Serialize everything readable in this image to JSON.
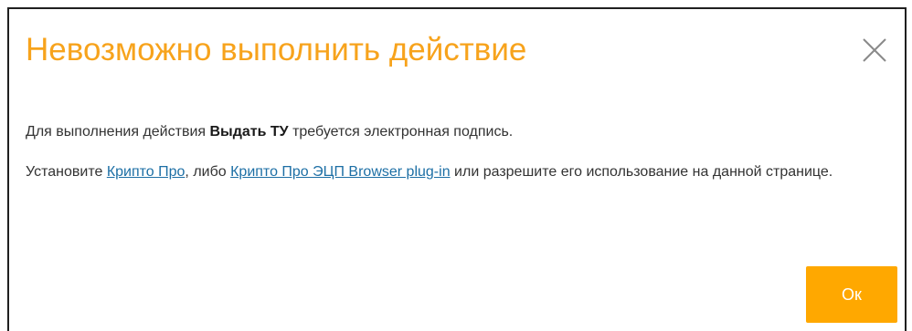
{
  "dialog": {
    "title": "Невозможно выполнить действие",
    "close_icon": "close-icon",
    "message": {
      "line1_prefix": "Для выполнения действия ",
      "line1_bold": "Выдать ТУ",
      "line1_suffix": " требуется электронная подпись.",
      "line2_prefix": "Установите ",
      "link1": "Крипто Про",
      "line2_mid": ", либо ",
      "link2": "Крипто Про ЭЦП Browser plug-in",
      "line2_suffix": " или разрешите его использование на данной странице."
    },
    "ok_label": "Ок"
  },
  "colors": {
    "title": "#f7a31c",
    "ok_button": "#ffa800",
    "link": "#1d6fa5",
    "text": "#333333"
  }
}
